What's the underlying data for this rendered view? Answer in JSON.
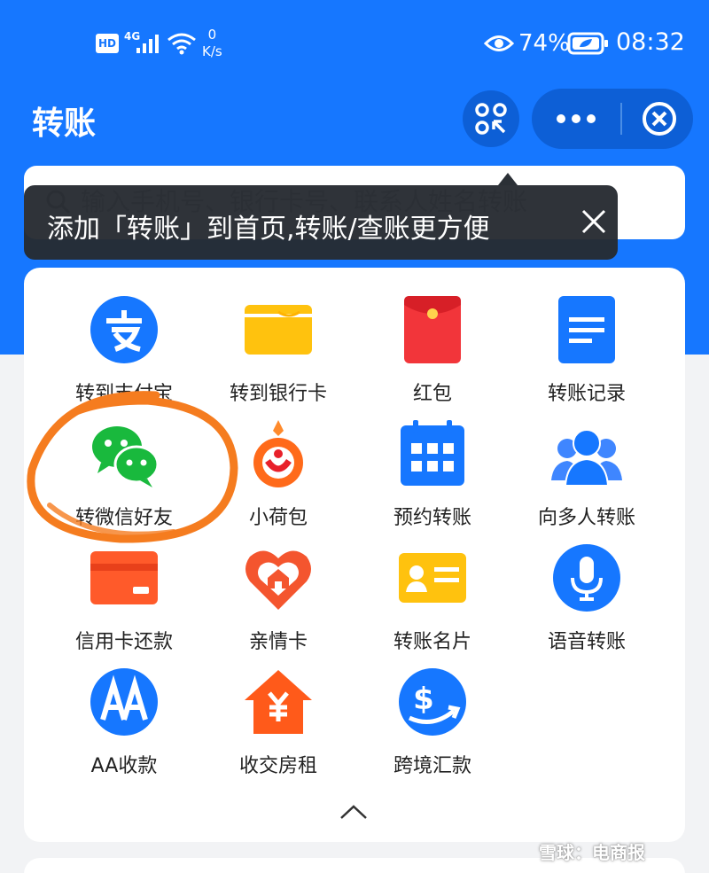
{
  "status_bar": {
    "hd": "HD",
    "network": "4G",
    "speed_value": "0",
    "speed_unit": "K/s",
    "battery": "74%",
    "time": "08:32"
  },
  "header": {
    "title": "转账"
  },
  "search": {
    "placeholder": "输入手机号、银行卡号、联系人姓名转账"
  },
  "tooltip": {
    "text": "添加「转账」到首页,转账/查账更方便"
  },
  "services": [
    {
      "label": "转到支付宝",
      "icon": "alipay-icon"
    },
    {
      "label": "转到银行卡",
      "icon": "bank-card-icon"
    },
    {
      "label": "红包",
      "icon": "red-envelope-icon"
    },
    {
      "label": "转账记录",
      "icon": "record-icon"
    },
    {
      "label": "转微信好友",
      "icon": "wechat-icon"
    },
    {
      "label": "小荷包",
      "icon": "purse-icon"
    },
    {
      "label": "预约转账",
      "icon": "calendar-icon"
    },
    {
      "label": "向多人转账",
      "icon": "group-icon"
    },
    {
      "label": "信用卡还款",
      "icon": "credit-card-icon"
    },
    {
      "label": "亲情卡",
      "icon": "family-card-icon"
    },
    {
      "label": "转账名片",
      "icon": "business-card-icon"
    },
    {
      "label": "语音转账",
      "icon": "microphone-icon"
    },
    {
      "label": "AA收款",
      "icon": "aa-icon"
    },
    {
      "label": "收交房租",
      "icon": "rent-house-icon"
    },
    {
      "label": "跨境汇款",
      "icon": "cross-border-icon"
    }
  ],
  "watermark": "雪球：电商报",
  "colors": {
    "brand": "#1677ff",
    "annotation": "#f57c1f"
  }
}
